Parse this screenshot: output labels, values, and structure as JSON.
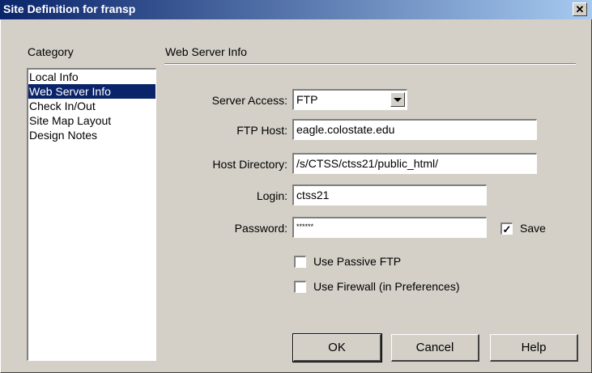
{
  "window": {
    "title": "Site Definition for fransp",
    "close_glyph": "✕"
  },
  "category": {
    "heading": "Category",
    "items": [
      "Local Info",
      "Web Server Info",
      "Check In/Out",
      "Site Map Layout",
      "Design Notes"
    ],
    "selected": "Web Server Info"
  },
  "panel": {
    "heading": "Web Server Info"
  },
  "form": {
    "server_access": {
      "label": "Server Access:",
      "value": "FTP"
    },
    "ftp_host": {
      "label": "FTP Host:",
      "value": "eagle.colostate.edu"
    },
    "host_directory": {
      "label": "Host Directory:",
      "value": "/s/CTSS/ctss21/public_html/"
    },
    "login": {
      "label": "Login:",
      "value": "ctss21"
    },
    "password": {
      "label": "Password:",
      "value": "******"
    },
    "save": {
      "label": "Save",
      "checked": true
    },
    "passive_ftp": {
      "label": "Use Passive FTP",
      "checked": false
    },
    "firewall": {
      "label": "Use Firewall (in Preferences)",
      "checked": false
    }
  },
  "buttons": {
    "ok": "OK",
    "cancel": "Cancel",
    "help": "Help"
  }
}
